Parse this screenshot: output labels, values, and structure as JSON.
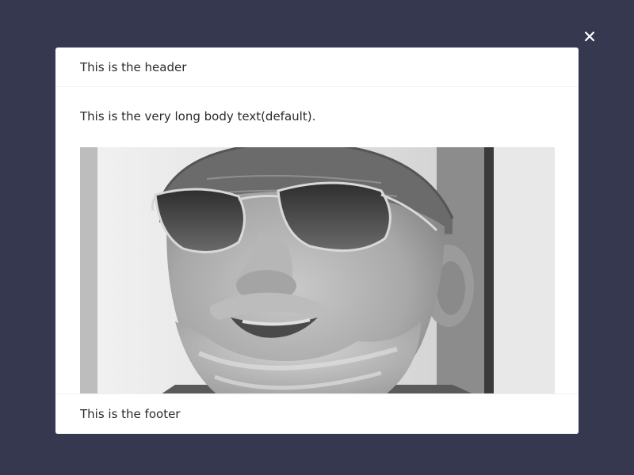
{
  "modal": {
    "header_text": "This is the header",
    "body_text": "This is the very long body text(default).",
    "footer_text": "This is the footer",
    "close_icon": "close-icon",
    "image_subject": "grayscale-portrait-man-sunglasses"
  },
  "colors": {
    "backdrop": "#363850",
    "modal_bg": "#ffffff",
    "text": "#2b2b2b",
    "close_icon": "#ffffff"
  }
}
